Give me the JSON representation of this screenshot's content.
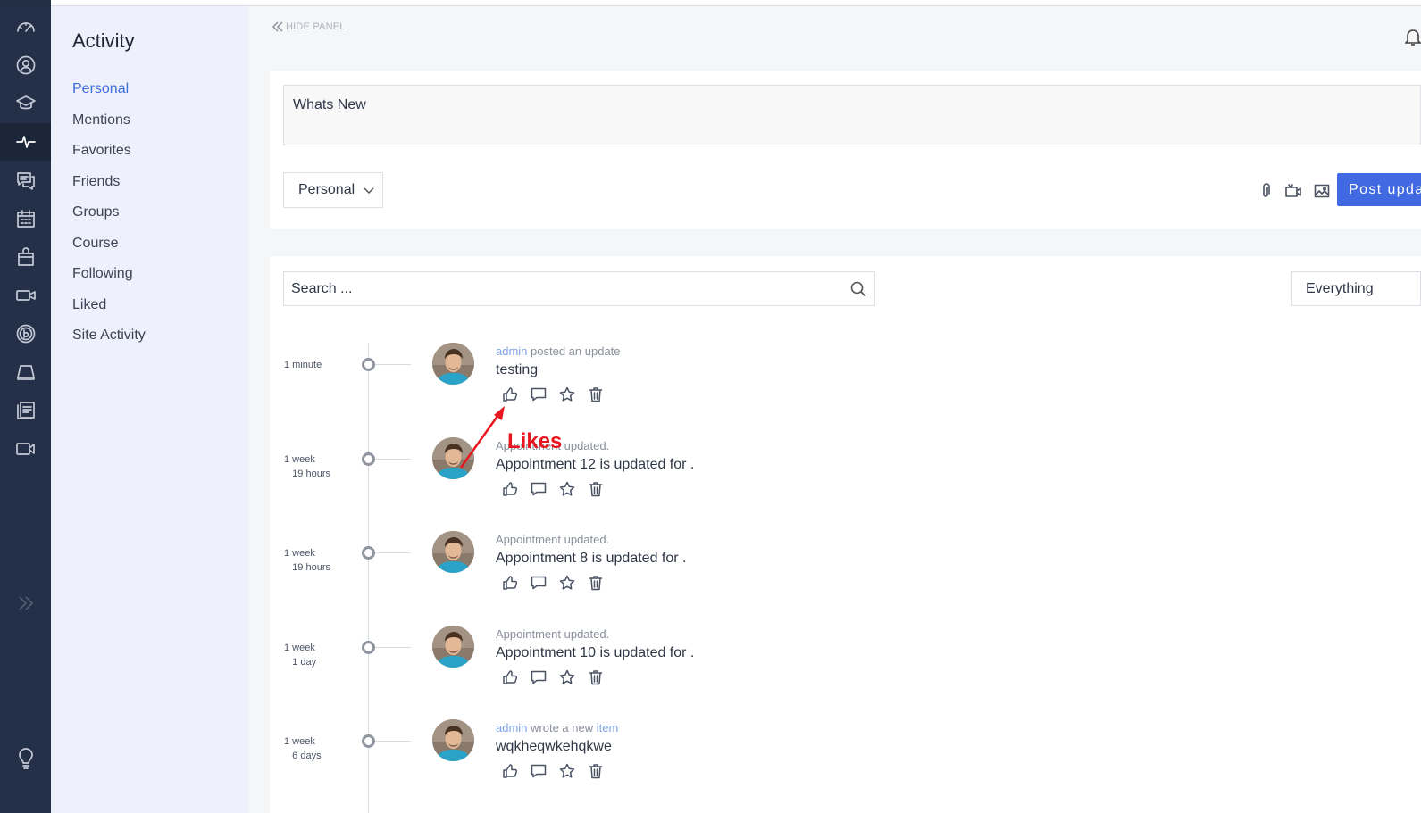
{
  "rail": {
    "items": [
      {
        "icon": "dashboard-icon"
      },
      {
        "icon": "profile-icon"
      },
      {
        "icon": "courses-icon"
      },
      {
        "icon": "activity-icon",
        "active": true
      },
      {
        "icon": "messages-icon"
      },
      {
        "icon": "calendar-icon"
      },
      {
        "icon": "shop-icon"
      },
      {
        "icon": "video-icon"
      },
      {
        "icon": "buddyboss-icon"
      },
      {
        "icon": "drive-icon"
      },
      {
        "icon": "documents-icon"
      },
      {
        "icon": "zoom-icon"
      }
    ],
    "bottom_icon": "lightbulb-icon"
  },
  "subnav": {
    "title": "Activity",
    "items": [
      {
        "label": "Personal",
        "active": true
      },
      {
        "label": "Mentions"
      },
      {
        "label": "Favorites"
      },
      {
        "label": "Friends"
      },
      {
        "label": "Groups"
      },
      {
        "label": "Course"
      },
      {
        "label": "Following"
      },
      {
        "label": "Liked"
      },
      {
        "label": "Site Activity"
      }
    ]
  },
  "header": {
    "hide_panel_label": "HIDE PANEL"
  },
  "composer": {
    "placeholder": "Whats New",
    "privacy_value": "Personal",
    "post_label": "Post update"
  },
  "feed": {
    "search_placeholder": "Search ...",
    "filter_value": "Everything",
    "entries": [
      {
        "time": "1 minute",
        "actor": "admin",
        "action": " posted an update",
        "content": "testing"
      },
      {
        "time": "1 week\n   19 hours",
        "actor": "",
        "action": "Appointment updated.",
        "content": "Appointment 12 is updated for ."
      },
      {
        "time": "1 week\n   19 hours",
        "actor": "",
        "action": "Appointment updated.",
        "content": "Appointment 8 is updated for ."
      },
      {
        "time": "1 week\n   1 day",
        "actor": "",
        "action": "Appointment updated.",
        "content": "Appointment 10 is updated for ."
      },
      {
        "time": "1 week\n   6 days",
        "actor": "admin",
        "action": " wrote a new ",
        "object": "item",
        "content": "wqkheqwkehqkwe"
      }
    ]
  },
  "annotation": {
    "label": "Likes",
    "color": "#e8161e"
  },
  "colors": {
    "rail_bg": "#233047",
    "subnav_bg": "#eef0fb",
    "accent": "#4169e1",
    "link": "#7ea2e6"
  }
}
